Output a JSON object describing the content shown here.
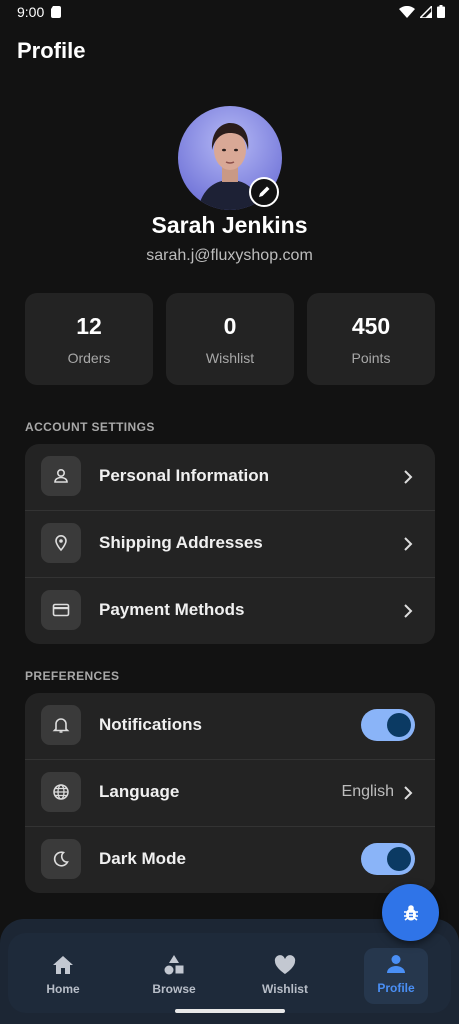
{
  "status_bar": {
    "time": "9:00"
  },
  "header": {
    "title": "Profile"
  },
  "profile": {
    "name": "Sarah Jenkins",
    "email": "sarah.j@fluxyshop.com"
  },
  "stats": [
    {
      "value": "12",
      "label": "Orders"
    },
    {
      "value": "0",
      "label": "Wishlist"
    },
    {
      "value": "450",
      "label": "Points"
    }
  ],
  "account_settings": {
    "title": "ACCOUNT SETTINGS",
    "items": [
      {
        "label": "Personal Information",
        "icon": "person-icon"
      },
      {
        "label": "Shipping Addresses",
        "icon": "location-pin-icon"
      },
      {
        "label": "Payment Methods",
        "icon": "credit-card-icon"
      }
    ]
  },
  "preferences": {
    "title": "PREFERENCES",
    "items": [
      {
        "label": "Notifications",
        "icon": "bell-icon",
        "toggle_on": true
      },
      {
        "label": "Language",
        "icon": "globe-icon",
        "value": "English"
      },
      {
        "label": "Dark Mode",
        "icon": "moon-icon",
        "toggle_on": true
      }
    ]
  },
  "bottom_nav": {
    "items": [
      {
        "label": "Home",
        "icon": "home-icon"
      },
      {
        "label": "Browse",
        "icon": "shapes-icon"
      },
      {
        "label": "Wishlist",
        "icon": "heart-icon"
      },
      {
        "label": "Profile",
        "icon": "person-icon",
        "active": true
      }
    ]
  },
  "colors": {
    "accent": "#4a8ff5",
    "fab": "#2f74e8",
    "toggle_track": "#8ab4f8",
    "toggle_knob": "#0b3a63"
  }
}
